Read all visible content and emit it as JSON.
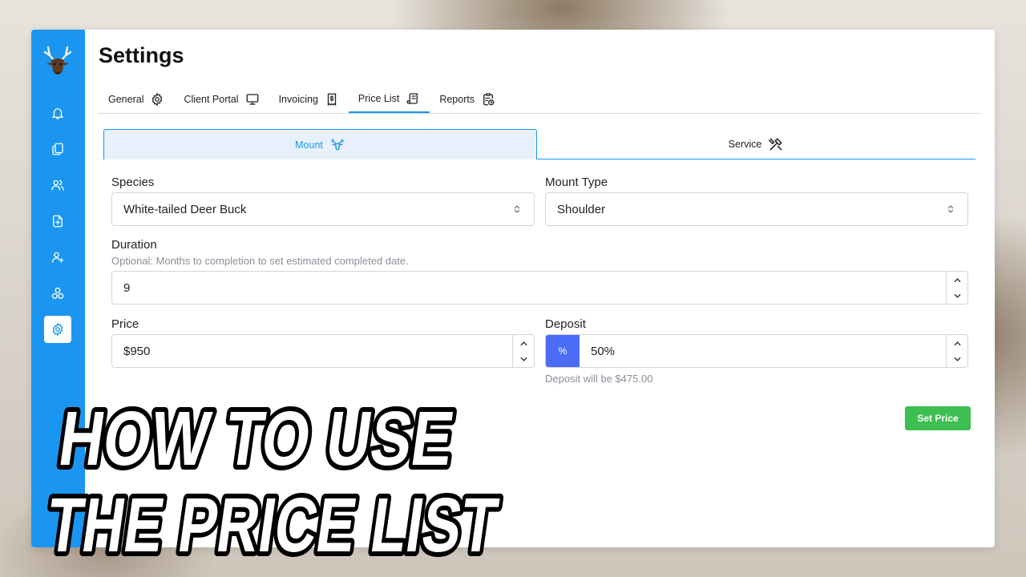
{
  "page": {
    "title": "Settings"
  },
  "tabs": [
    {
      "label": "General",
      "icon": "gear-icon"
    },
    {
      "label": "Client Portal",
      "icon": "monitor-icon"
    },
    {
      "label": "Invoicing",
      "icon": "receipt-icon"
    },
    {
      "label": "Price List",
      "icon": "scroll-icon",
      "active": true
    },
    {
      "label": "Reports",
      "icon": "clipboard-clock-icon"
    }
  ],
  "subtabs": {
    "mount": {
      "label": "Mount",
      "icon": "deer-icon"
    },
    "service": {
      "label": "Service",
      "icon": "tools-icon"
    }
  },
  "form": {
    "species": {
      "label": "Species",
      "value": "White-tailed Deer Buck"
    },
    "mount_type": {
      "label": "Mount Type",
      "value": "Shoulder"
    },
    "duration": {
      "label": "Duration",
      "hint": "Optional: Months to completion to set estimated completed date.",
      "value": "9"
    },
    "price": {
      "label": "Price",
      "value": "$950"
    },
    "deposit": {
      "label": "Deposit",
      "unit_symbol": "%",
      "value": "50%",
      "hint": "Deposit will be $475.00"
    },
    "submit_label": "Set Price"
  },
  "overlay": {
    "line1": "HOW TO USE",
    "line2": "THE PRICE LIST"
  },
  "colors": {
    "sidebar": "#1a96f0",
    "accent": "#1a96f0",
    "percent_button": "#4a6cf7",
    "submit_button": "#3cbf50"
  }
}
